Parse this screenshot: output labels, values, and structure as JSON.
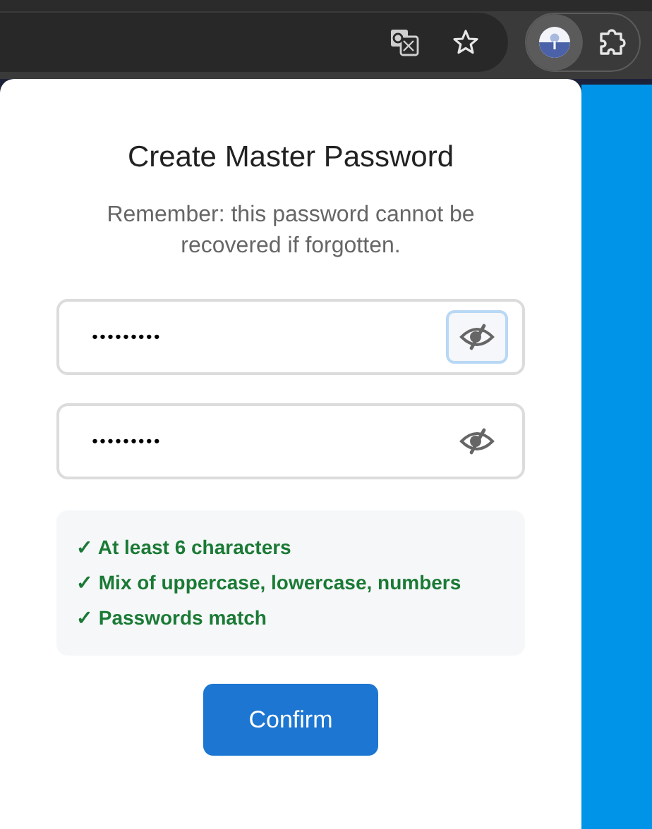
{
  "browser": {
    "extension_pressed": true
  },
  "dialog": {
    "title": "Create Master Password",
    "message": "Remember: this password cannot be recovered if forgotten.",
    "fields": [
      {
        "value": "•••••••••",
        "toggle_focused": true
      },
      {
        "value": "•••••••••",
        "toggle_focused": false
      }
    ],
    "requirements": [
      {
        "mark": "✓",
        "text": "At least 6 characters",
        "met": true
      },
      {
        "mark": "✓",
        "text": "Mix of uppercase, lowercase, numbers",
        "met": true
      },
      {
        "mark": "✓",
        "text": "Passwords match",
        "met": true
      }
    ],
    "button": "Confirm"
  }
}
